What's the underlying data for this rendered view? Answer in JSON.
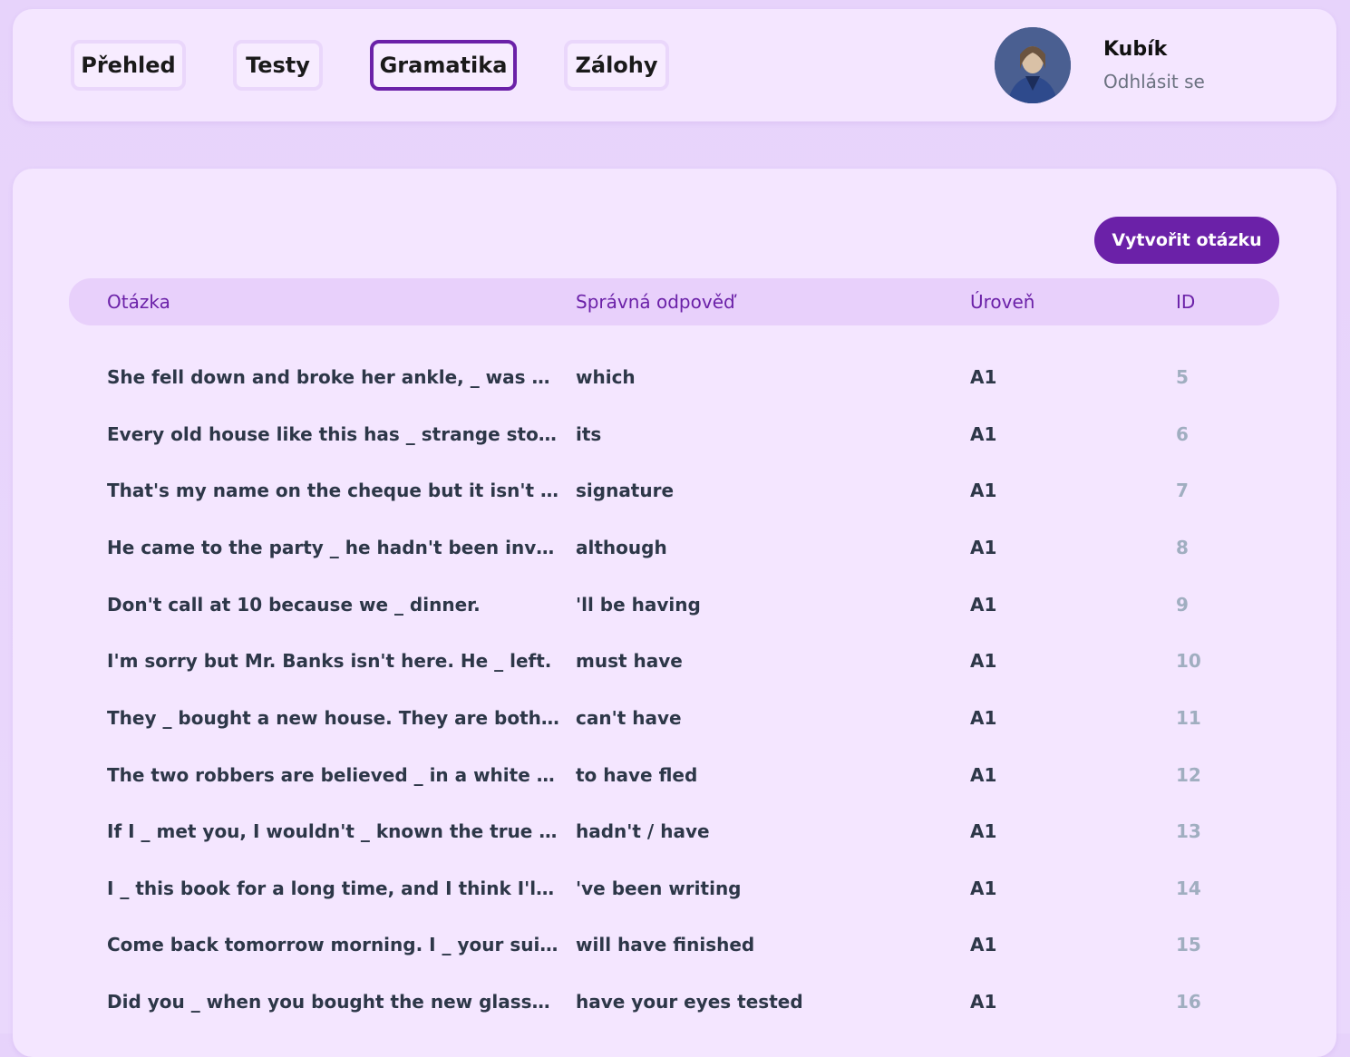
{
  "nav": {
    "items": [
      {
        "label": "Přehled",
        "active": false
      },
      {
        "label": "Testy",
        "active": false
      },
      {
        "label": "Gramatika",
        "active": true
      },
      {
        "label": "Zálohy",
        "active": false
      }
    ]
  },
  "user": {
    "name": "Kubík",
    "logout_label": "Odhlásit se"
  },
  "main": {
    "create_button_label": "Vytvořit otázku",
    "table": {
      "headers": {
        "question": "Otázka",
        "answer": "Správná odpověď",
        "level": "Úroveň",
        "id": "ID"
      },
      "rows": [
        {
          "question": "She fell down and broke her ankle, _ was a pity.",
          "answer": "which",
          "level": "A1",
          "id": "5"
        },
        {
          "question": "Every old house like this has _ strange stories.",
          "answer": "its",
          "level": "A1",
          "id": "6"
        },
        {
          "question": "That's my name on the cheque but it isn't my _ .",
          "answer": "signature",
          "level": "A1",
          "id": "7"
        },
        {
          "question": "He came to the party _ he hadn't been invited.",
          "answer": "although",
          "level": "A1",
          "id": "8"
        },
        {
          "question": "Don't call at 10 because we _ dinner.",
          "answer": "'ll be having",
          "level": "A1",
          "id": "9"
        },
        {
          "question": "I'm sorry but Mr. Banks isn't here. He _ left.",
          "answer": "must have",
          "level": "A1",
          "id": "10"
        },
        {
          "question": "They _ bought a new house. They are both unem...",
          "answer": "can't have",
          "level": "A1",
          "id": "11"
        },
        {
          "question": "The two robbers are believed _ in a white sports ...",
          "answer": "to have fled",
          "level": "A1",
          "id": "12"
        },
        {
          "question": "If I _ met you, I wouldn't _ known the true meani...",
          "answer": "hadn't / have",
          "level": "A1",
          "id": "13"
        },
        {
          "question": "I _ this book for a long time, and I think I'll never ...",
          "answer": "'ve been writing",
          "level": "A1",
          "id": "14"
        },
        {
          "question": "Come back tomorrow morning. I _ your suit by th...",
          "answer": "will have finished",
          "level": "A1",
          "id": "15"
        },
        {
          "question": "Did you _ when you bought the new glasses?",
          "answer": "have your eyes tested",
          "level": "A1",
          "id": "16"
        }
      ]
    }
  }
}
